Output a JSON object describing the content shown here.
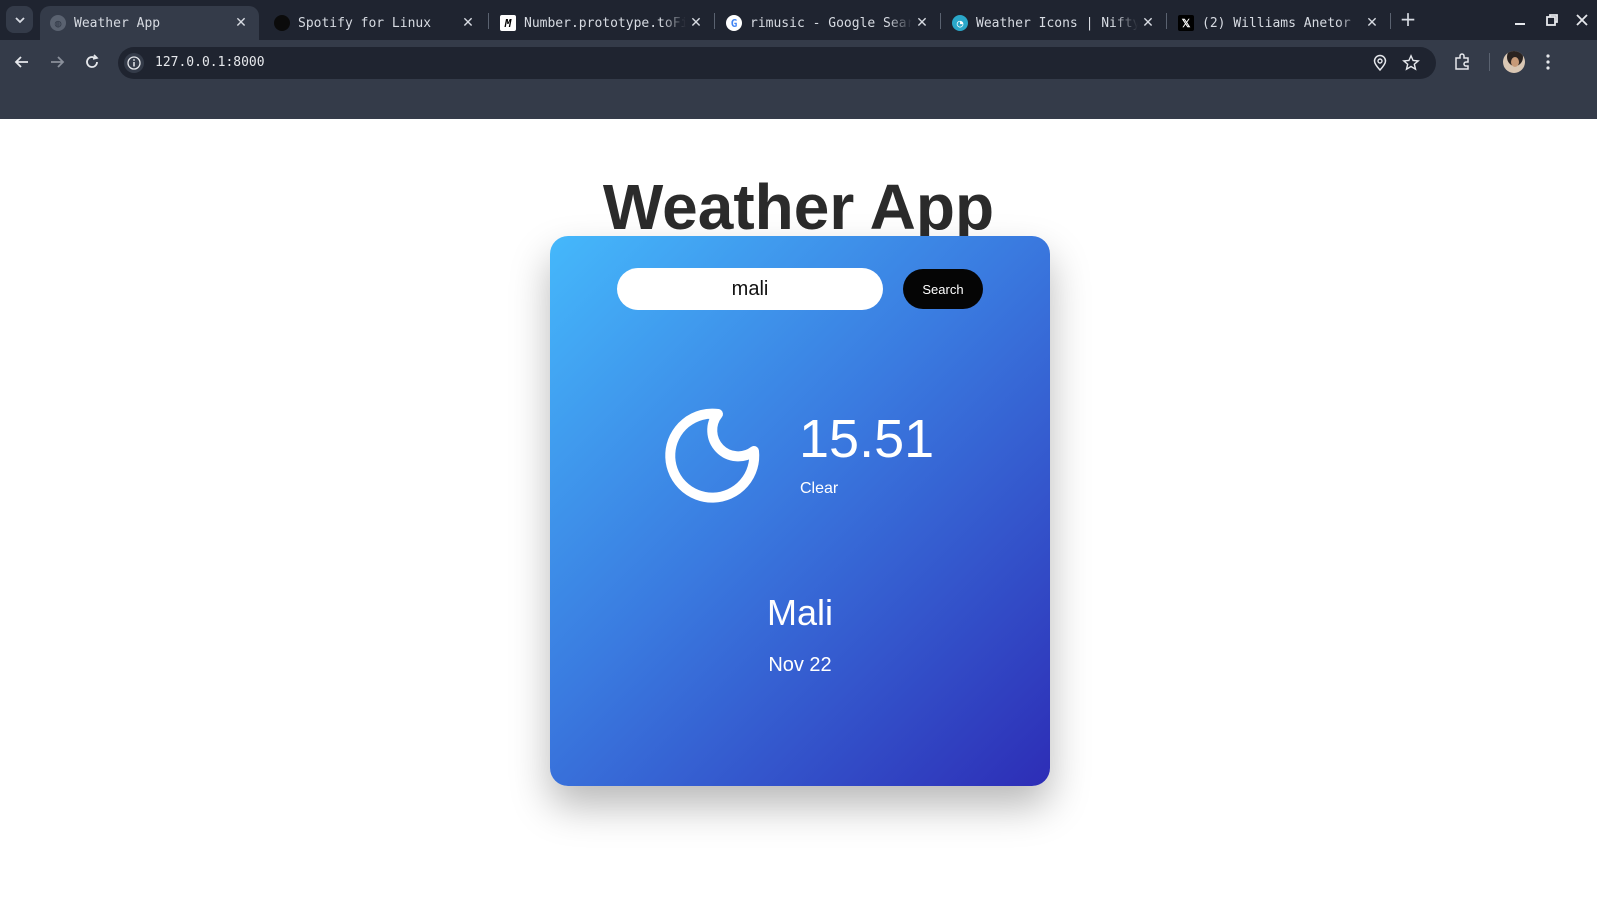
{
  "browser": {
    "tabs": [
      {
        "title": "Weather App",
        "active": true,
        "favicon": "globe-icon"
      },
      {
        "title": "Spotify for Linux",
        "active": false,
        "favicon": "spotify-icon"
      },
      {
        "title": "Number.prototype.toFixed()",
        "active": false,
        "favicon": "mdn-icon"
      },
      {
        "title": "rimusic - Google Search",
        "active": false,
        "favicon": "google-icon"
      },
      {
        "title": "Weather Icons | Nifty",
        "active": false,
        "favicon": "nifty-icon"
      },
      {
        "title": "(2) Williams Anetor",
        "active": false,
        "favicon": "x-icon"
      }
    ],
    "url": "127.0.0.1:8000"
  },
  "page": {
    "title": "Weather App"
  },
  "search": {
    "value": "mali",
    "button_label": "Search"
  },
  "weather": {
    "icon": "moon-icon",
    "temperature": "15.51",
    "condition": "Clear",
    "city": "Mali",
    "date": "Nov 22"
  },
  "colors": {
    "card_gradient_start": "#45b8fb",
    "card_gradient_end": "#2d2db6",
    "button_bg": "#050505"
  }
}
